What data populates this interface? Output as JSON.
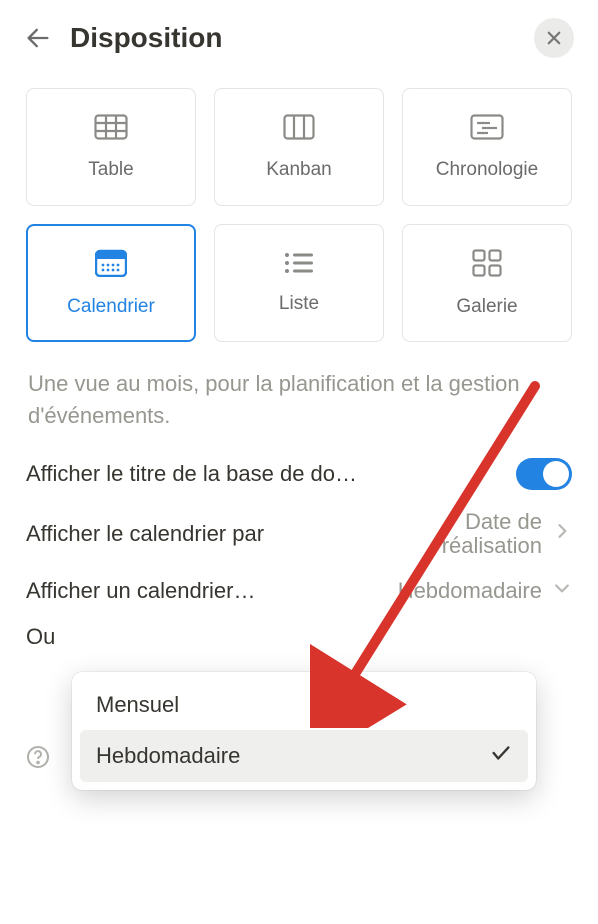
{
  "header": {
    "title": "Disposition"
  },
  "layouts": [
    {
      "id": "table",
      "label": "Table"
    },
    {
      "id": "kanban",
      "label": "Kanban"
    },
    {
      "id": "timeline",
      "label": "Chronologie"
    },
    {
      "id": "calendar",
      "label": "Calendrier",
      "selected": true
    },
    {
      "id": "list",
      "label": "Liste"
    },
    {
      "id": "gallery",
      "label": "Galerie"
    }
  ],
  "description": "Une vue au mois, pour la planification et la gestion d'événements.",
  "settings": {
    "show_title_label": "Afficher le titre de la base de do…",
    "show_title_value": true,
    "calendar_by_label": "Afficher le calendrier par",
    "calendar_by_value": "Date de réalisation",
    "calendar_as_label": "Afficher un calendrier…",
    "calendar_as_value": "Hebdomadaire",
    "truncated_label": "Ou",
    "help_label": ""
  },
  "dropdown": {
    "options": [
      {
        "label": "Mensuel",
        "selected": false
      },
      {
        "label": "Hebdomadaire",
        "selected": true
      }
    ]
  },
  "colors": {
    "accent": "#2383e2",
    "annotation": "#d9342b"
  }
}
